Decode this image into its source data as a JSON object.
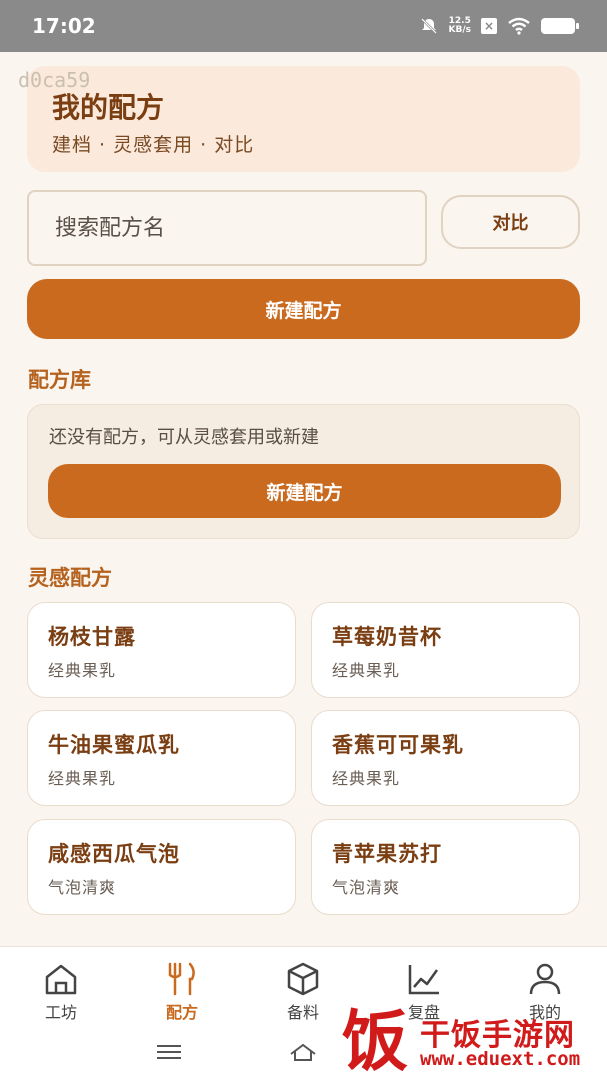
{
  "status_bar": {
    "time": "17:02",
    "net_speed_value": "12.5",
    "net_speed_unit": "KB/s"
  },
  "watermark_id": "d0ca59",
  "header": {
    "title": "我的配方",
    "subtitle": "建档 · 灵感套用 · 对比"
  },
  "search": {
    "placeholder": "搜索配方名",
    "compare_label": "对比"
  },
  "new_recipe_label": "新建配方",
  "library": {
    "title": "配方库",
    "empty_text": "还没有配方，可从灵感套用或新建",
    "new_label": "新建配方"
  },
  "inspiration": {
    "title": "灵感配方",
    "cards": [
      {
        "name": "杨枝甘露",
        "tag": "经典果乳"
      },
      {
        "name": "草莓奶昔杯",
        "tag": "经典果乳"
      },
      {
        "name": "牛油果蜜瓜乳",
        "tag": "经典果乳"
      },
      {
        "name": "香蕉可可果乳",
        "tag": "经典果乳"
      },
      {
        "name": "咸感西瓜气泡",
        "tag": "气泡清爽"
      },
      {
        "name": "青苹果苏打",
        "tag": "气泡清爽"
      }
    ]
  },
  "nav": {
    "items": [
      {
        "label": "工坊",
        "icon": "home-icon"
      },
      {
        "label": "配方",
        "icon": "fork-knife-icon",
        "active": true
      },
      {
        "label": "备料",
        "icon": "box-icon"
      },
      {
        "label": "复盘",
        "icon": "chart-icon"
      },
      {
        "label": "我的",
        "icon": "user-icon"
      }
    ]
  },
  "site_watermark": {
    "mark": "饭",
    "name": "干饭手游网",
    "url": "www.eduext.com"
  },
  "colors": {
    "accent": "#c96a1f",
    "title_brown": "#7a3e12",
    "background": "#faf5ee",
    "header_bg": "#fbe9dc"
  }
}
